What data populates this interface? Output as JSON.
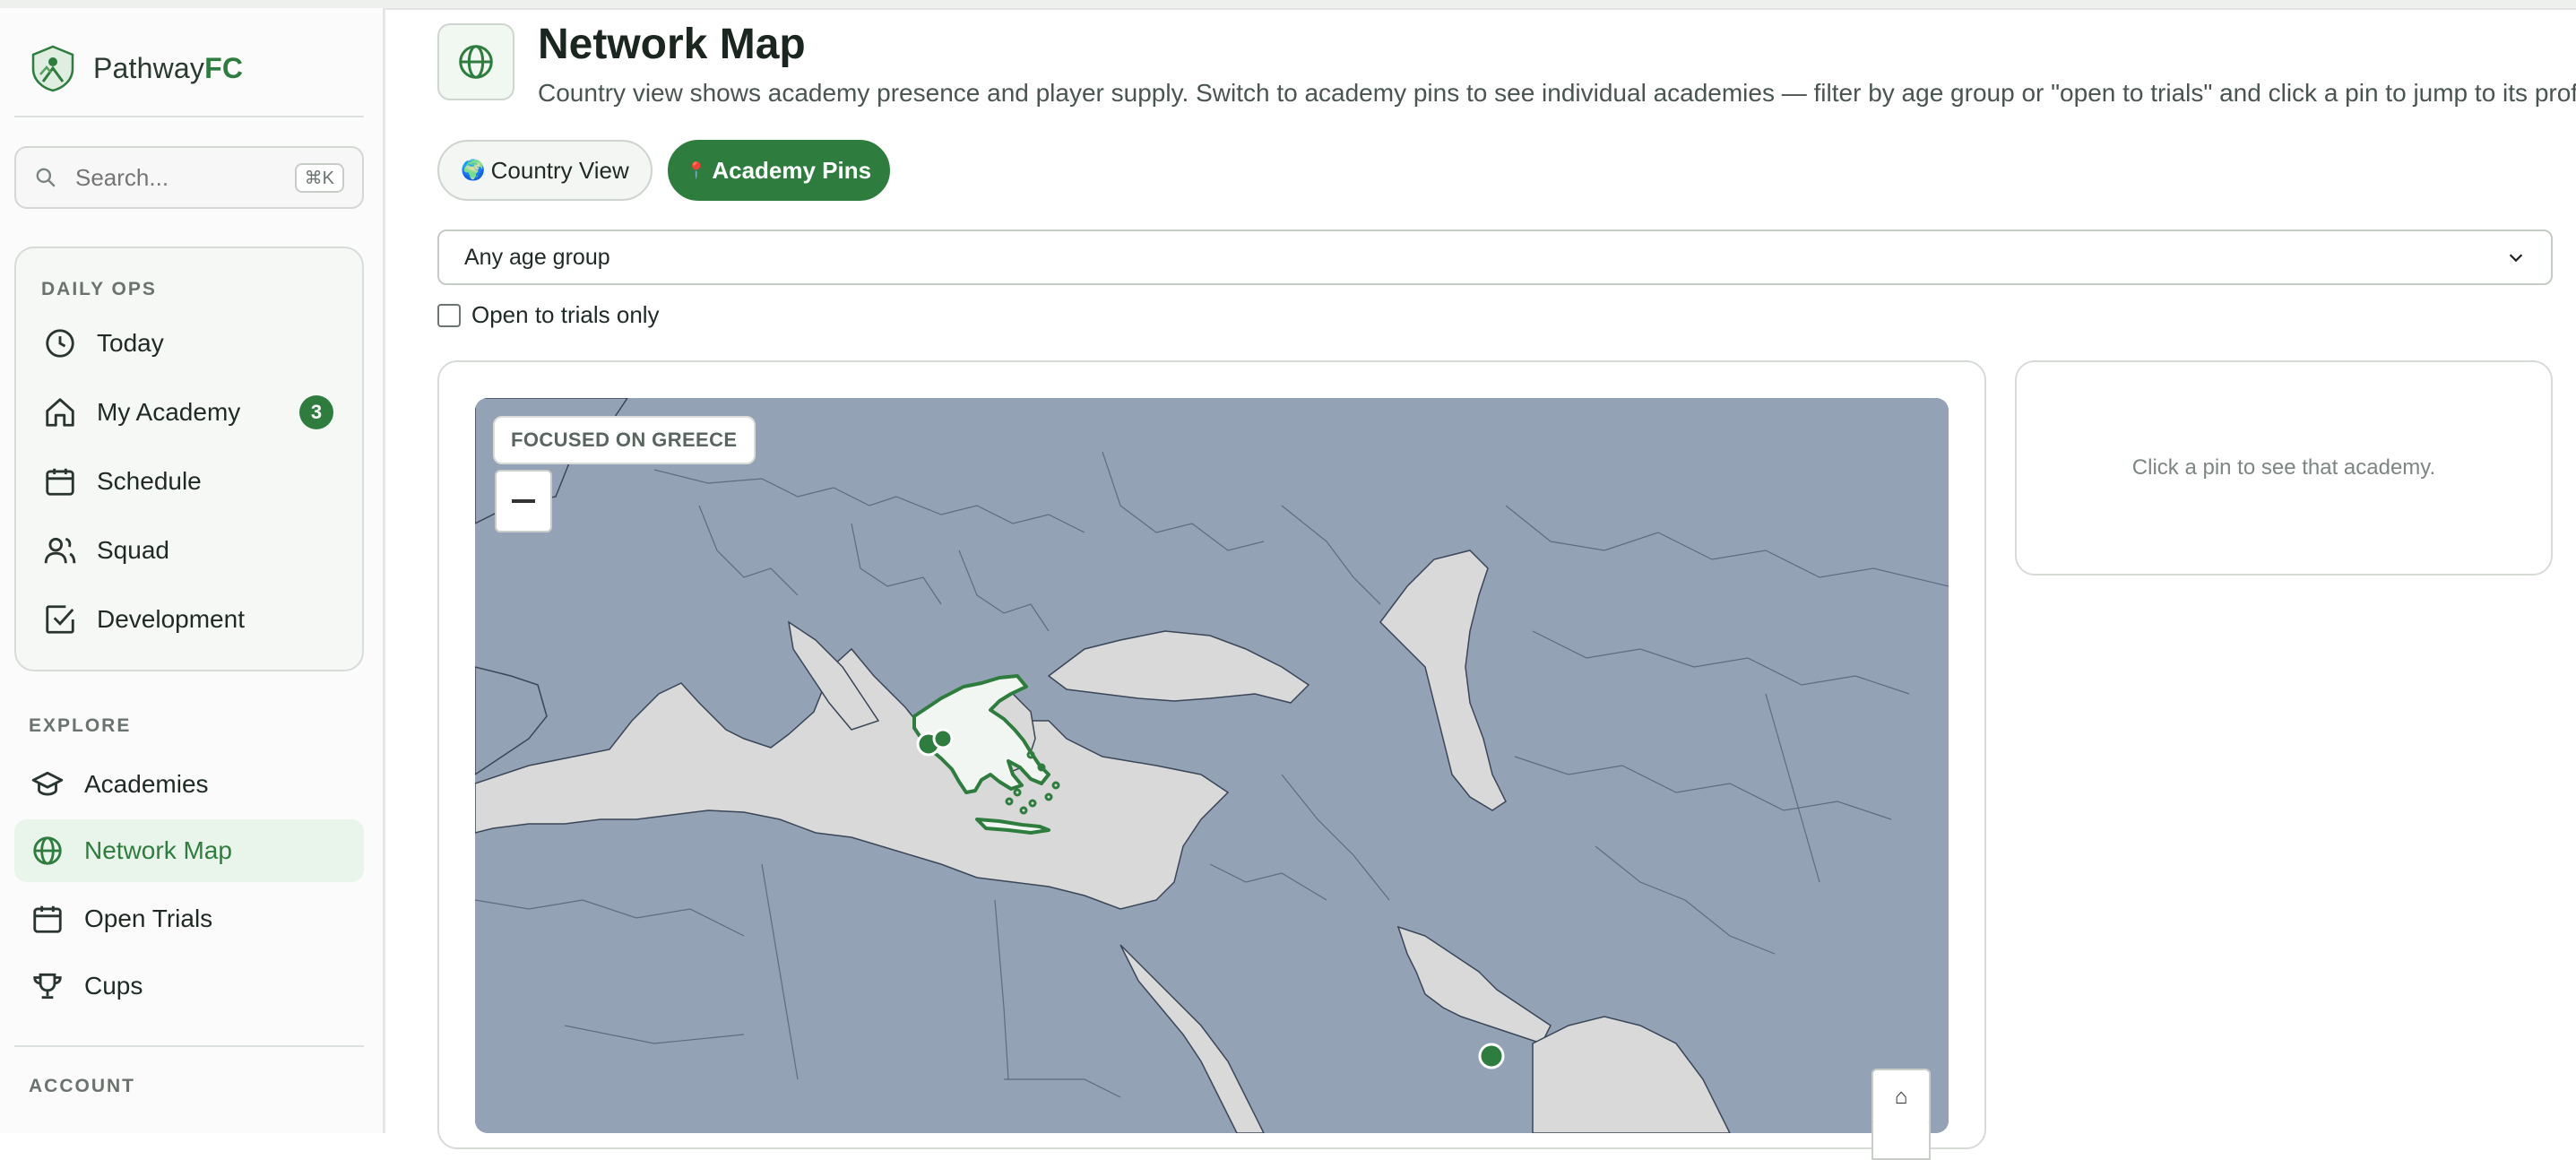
{
  "brand": {
    "name_prefix": "Pathway",
    "name_suffix": "FC"
  },
  "search": {
    "placeholder": "Search...",
    "shortcut": "⌘K"
  },
  "sidebar": {
    "daily_ops": {
      "label": "DAILY OPS",
      "items": [
        {
          "label": "Today",
          "icon": "clock-icon"
        },
        {
          "label": "My Academy",
          "icon": "home-icon",
          "badge": "3"
        },
        {
          "label": "Schedule",
          "icon": "calendar-icon"
        },
        {
          "label": "Squad",
          "icon": "users-icon"
        },
        {
          "label": "Development",
          "icon": "check-square-icon"
        }
      ]
    },
    "explore": {
      "label": "EXPLORE",
      "items": [
        {
          "label": "Academies",
          "icon": "graduation-cap-icon"
        },
        {
          "label": "Network Map",
          "icon": "globe-icon",
          "active": true
        },
        {
          "label": "Open Trials",
          "icon": "calendar-icon"
        },
        {
          "label": "Cups",
          "icon": "trophy-icon"
        }
      ]
    },
    "account": {
      "label": "ACCOUNT"
    }
  },
  "page": {
    "title": "Network Map",
    "description": "Country view shows academy presence and player supply. Switch to academy pins to see individual academies — filter by age group or \"open to trials\" and click a pin to jump to its profile."
  },
  "view_toggle": {
    "country": {
      "icon": "🌍",
      "label": "Country View"
    },
    "pins": {
      "icon": "📍",
      "label": "Academy Pins",
      "selected": true
    }
  },
  "filters": {
    "age_group": {
      "selected": "Any age group"
    },
    "open_to_trials": {
      "label": "Open to trials only",
      "checked": false
    }
  },
  "map": {
    "focus_chip": "FOCUSED ON GREECE",
    "zoom_out": "−",
    "home": "⌂",
    "colors": {
      "water": "#94a2b6",
      "land": "#d9d9d9",
      "focus": "#2e7d3e",
      "focus_fill": "#f2f6f2"
    }
  },
  "detail_panel": {
    "empty_text": "Click a pin to see that academy."
  },
  "colors": {
    "accent": "#2e7d3e",
    "accent_light": "#e9f4ea"
  }
}
